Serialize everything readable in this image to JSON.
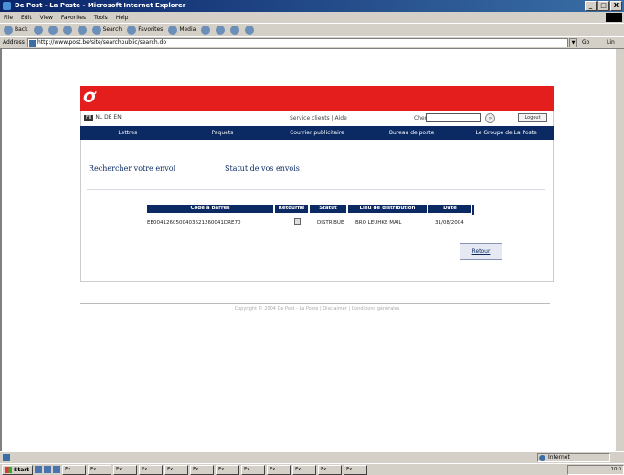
{
  "window": {
    "title": "De Post - La Poste - Microsoft Internet Explorer",
    "controls": [
      "_",
      "□",
      "X"
    ]
  },
  "menu": [
    "File",
    "Edit",
    "View",
    "Favorites",
    "Tools",
    "Help"
  ],
  "toolbar": {
    "back": "Back",
    "search": "Search",
    "favorites": "Favorites",
    "media": "Media"
  },
  "address": {
    "label": "Address",
    "url": "http://www.post.be/site/searchpublic/search.do",
    "go": "Go",
    "links": "Lin"
  },
  "site": {
    "logo": "Ơ",
    "lang": {
      "active": "FR",
      "others": "NL DE EN"
    },
    "util_links": "Service clients | Aide",
    "search_label": "Chercher :",
    "search_go": "»",
    "login": "Logout",
    "nav": [
      "Lettres",
      "Paquets",
      "Courrier publicitaire",
      "Bureau de poste",
      "Le Groupe de La Poste"
    ],
    "tabs": {
      "search": "Rechercher votre envoi",
      "status": "Statut de vos envois"
    },
    "results": {
      "headers": [
        "Code à barres",
        "Retourné",
        "Statut",
        "Lieu de distribution",
        "Date"
      ],
      "row": [
        "EE0041260500403621260041DRE70",
        "",
        "DISTRIBUE",
        "BRQ LEUHKE MAIL",
        "31/08/2004"
      ]
    },
    "return_button": "Retour",
    "copyright": "Copyright © 2004 De Post - La Poste | Disclaimer | Conditions générales"
  },
  "status": {
    "zone": "Internet"
  },
  "taskbar": {
    "start": "Start",
    "tasks": [
      "Ex...",
      "Ex...",
      "Ex...",
      "Ex...",
      "Ex...",
      "Ex...",
      "Ex...",
      "Ex...",
      "Ex...",
      "Ex...",
      "Ex...",
      "Ex..."
    ],
    "clock": "10:0"
  }
}
